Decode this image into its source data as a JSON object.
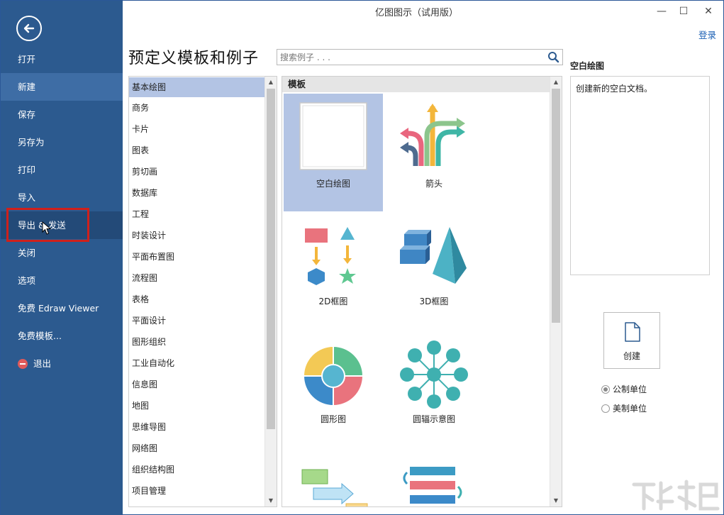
{
  "window": {
    "title": "亿图图示（试用版）",
    "login_label": "登录"
  },
  "sidebar": {
    "items": [
      {
        "label": "打开"
      },
      {
        "label": "新建"
      },
      {
        "label": "保存"
      },
      {
        "label": "另存为"
      },
      {
        "label": "打印"
      },
      {
        "label": "导入"
      },
      {
        "label": "导出 & 发送"
      },
      {
        "label": "关闭"
      },
      {
        "label": "选项"
      },
      {
        "label": "免费 Edraw Viewer"
      },
      {
        "label": "免费模板..."
      },
      {
        "label": "退出"
      }
    ],
    "active_item": "新建",
    "hovered_item": "导出 & 发送"
  },
  "main": {
    "heading": "预定义模板和例子",
    "search_placeholder": "搜索例子 . . ."
  },
  "categories": [
    "基本绘图",
    "商务",
    "卡片",
    "图表",
    "剪切画",
    "数据库",
    "工程",
    "时装设计",
    "平面布置图",
    "流程图",
    "表格",
    "平面设计",
    "图形组织",
    "工业自动化",
    "信息图",
    "地图",
    "思维导图",
    "网络图",
    "组织结构图",
    "项目管理"
  ],
  "selected_category": "基本绘图",
  "gallery": {
    "header": "模板",
    "tiles": [
      {
        "label": "空白绘图",
        "icon": "blank-drawing-icon",
        "selected": true
      },
      {
        "label": "箭头",
        "icon": "arrows-icon"
      },
      {
        "label": "2D框图",
        "icon": "2d-block-icon"
      },
      {
        "label": "3D框图",
        "icon": "3d-block-icon"
      },
      {
        "label": "圆形图",
        "icon": "circle-chart-icon"
      },
      {
        "label": "圆辐示意图",
        "icon": "radial-diagram-icon"
      }
    ]
  },
  "info": {
    "title": "空白绘图",
    "description": "创建新的空白文档。",
    "create_label": "创建",
    "units": [
      {
        "label": "公制单位",
        "checked": true
      },
      {
        "label": "美制单位",
        "checked": false
      }
    ]
  },
  "colors": {
    "sidebar_bg": "#2c5a8f",
    "sidebar_active": "#3e6da5",
    "selection": "#b3c4e4",
    "highlight_box": "#d0201b",
    "link": "#1a5fb4"
  }
}
